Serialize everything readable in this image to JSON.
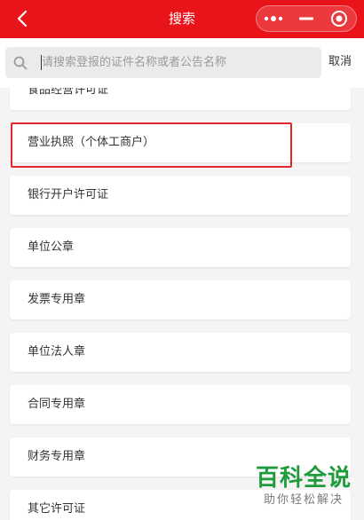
{
  "header": {
    "title": "搜索",
    "back_icon": "chevron-left-icon",
    "capsule": {
      "more_icon": "more-dots-icon",
      "minimize_icon": "minimize-icon",
      "close_icon": "target-close-icon"
    }
  },
  "search": {
    "placeholder": "请搜索登报的证件名称或者公告名称",
    "value": "",
    "icon": "search-icon",
    "cancel_label": "取消"
  },
  "list": {
    "items": [
      {
        "label": "食品经营许可证"
      },
      {
        "label": "营业执照（个体工商户）",
        "highlighted": true
      },
      {
        "label": "银行开户许可证"
      },
      {
        "label": "单位公章"
      },
      {
        "label": "发票专用章"
      },
      {
        "label": "单位法人章"
      },
      {
        "label": "合同专用章"
      },
      {
        "label": "财务专用章"
      },
      {
        "label": "其它许可证"
      }
    ]
  },
  "watermark": {
    "title": "百科全说",
    "subtitle": "助你轻松解决"
  },
  "colors": {
    "header_bg": "#e8141a",
    "highlight_border": "#e6262c",
    "watermark_green": "#1e9c3c"
  }
}
